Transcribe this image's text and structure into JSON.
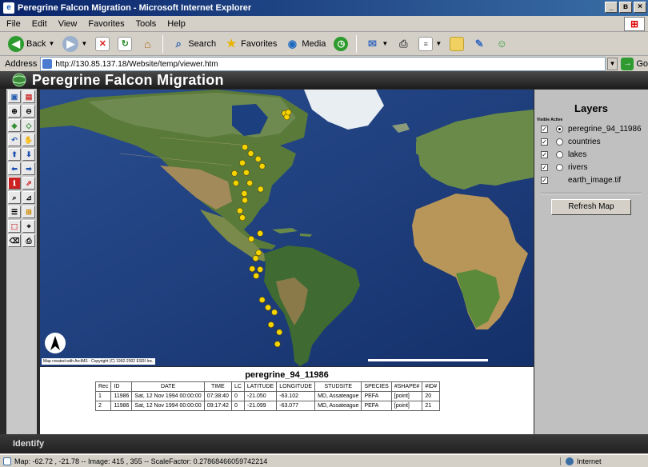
{
  "window": {
    "title": "Peregrine Falcon Migration - Microsoft Internet Explorer",
    "controls": [
      "_",
      "в",
      "×"
    ]
  },
  "menu": [
    "File",
    "Edit",
    "View",
    "Favorites",
    "Tools",
    "Help"
  ],
  "toolbar": {
    "back": "Back",
    "search": "Search",
    "favorites": "Favorites",
    "media": "Media"
  },
  "address": {
    "label": "Address",
    "url": "http://130.85.137.18/Website/temp/viewer.htm",
    "go": "Go"
  },
  "app": {
    "title": "Peregrine Falcon Migration",
    "identify": "Identify"
  },
  "map": {
    "credit": "Map created with ArcIMS - Copyright (C) 1992-2002 ESRI Inc.",
    "points": [
      [
        0.496,
        0.086
      ],
      [
        0.5,
        0.099
      ],
      [
        0.503,
        0.082
      ],
      [
        0.415,
        0.208
      ],
      [
        0.427,
        0.231
      ],
      [
        0.442,
        0.251
      ],
      [
        0.45,
        0.277
      ],
      [
        0.41,
        0.265
      ],
      [
        0.394,
        0.303
      ],
      [
        0.418,
        0.3
      ],
      [
        0.397,
        0.338
      ],
      [
        0.425,
        0.338
      ],
      [
        0.447,
        0.36
      ],
      [
        0.414,
        0.376
      ],
      [
        0.415,
        0.4
      ],
      [
        0.405,
        0.438
      ],
      [
        0.41,
        0.463
      ],
      [
        0.446,
        0.52
      ],
      [
        0.428,
        0.54
      ],
      [
        0.443,
        0.59
      ],
      [
        0.437,
        0.61
      ],
      [
        0.43,
        0.648
      ],
      [
        0.446,
        0.65
      ],
      [
        0.438,
        0.673
      ],
      [
        0.45,
        0.76
      ],
      [
        0.462,
        0.788
      ],
      [
        0.475,
        0.805
      ],
      [
        0.468,
        0.85
      ],
      [
        0.485,
        0.877
      ],
      [
        0.481,
        0.92
      ]
    ]
  },
  "layers": {
    "title": "Layers",
    "head": "Visible Active",
    "items": [
      {
        "name": "peregrine_94_11986",
        "visible": true,
        "radio": "on"
      },
      {
        "name": "countries",
        "visible": true,
        "radio": "off"
      },
      {
        "name": "lakes",
        "visible": true,
        "radio": "off"
      },
      {
        "name": "rivers",
        "visible": true,
        "radio": "off"
      },
      {
        "name": "earth_image.tif",
        "visible": true,
        "radio": "none"
      }
    ],
    "refresh": "Refresh Map"
  },
  "table": {
    "title": "peregrine_94_11986",
    "headers": [
      "Rec",
      "ID",
      "DATE",
      "TIME",
      "LC",
      "LATITUDE",
      "LONGITUDE",
      "STUDSITE",
      "SPECIES",
      "#SHAPE#",
      "#ID#"
    ],
    "rows": [
      [
        "1",
        "11986",
        "Sat, 12 Nov 1994 00:00:00",
        "07:38:40",
        "0",
        "-21.050",
        "-63.102",
        "MD, Assateague",
        "PEFA",
        "[point]",
        "20"
      ],
      [
        "2",
        "11986",
        "Sat, 12 Nov 1994 00:00:00",
        "09:17:42",
        "0",
        "-21.099",
        "-63.077",
        "MD, Assateague",
        "PEFA",
        "[point]",
        "21"
      ]
    ]
  },
  "status": {
    "message": "Map: -62.72 , -21.78 -- Image: 415 , 355 -- ScaleFactor: 0.27868466059742214",
    "zone": "Internet"
  },
  "colors": {
    "ocean": "#1a3a78",
    "point": "#f5d400",
    "titlebar": "#0a246a"
  }
}
